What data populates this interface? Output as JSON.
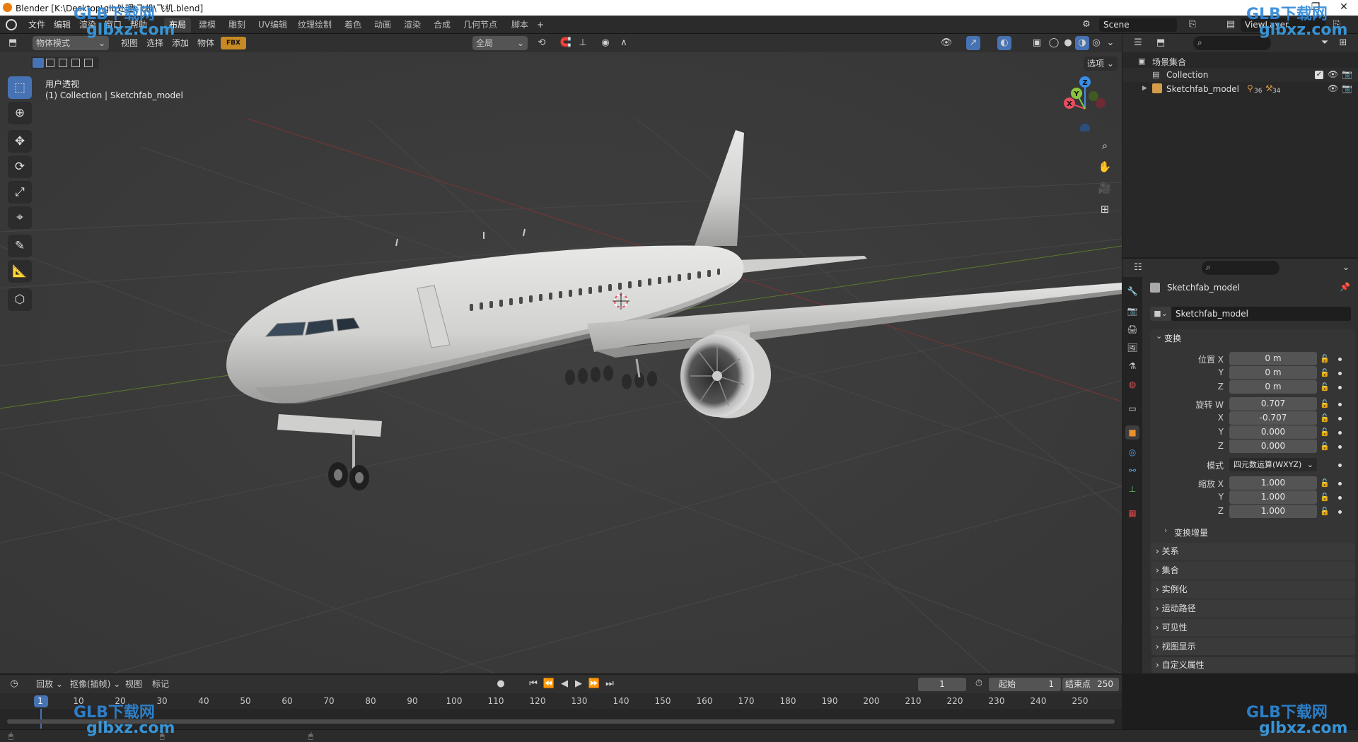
{
  "window": {
    "title": "Blender [K:\\Desktop\\glb处理\\飞机\\飞机.blend]",
    "controls": [
      "minimize",
      "maximize",
      "close"
    ]
  },
  "menubar": {
    "menus": [
      "文件",
      "编辑",
      "渲染",
      "窗口",
      "帮助"
    ],
    "workspaces": [
      "布局",
      "建模",
      "雕刻",
      "UV编辑",
      "纹理绘制",
      "着色",
      "动画",
      "渲染",
      "合成",
      "几何节点",
      "脚本"
    ],
    "active_workspace": "布局",
    "add_tab": "+",
    "scene": "Scene",
    "view_layer": "ViewLayer"
  },
  "viewport_header": {
    "mode": "物体模式",
    "menus": [
      "视图",
      "选择",
      "添加",
      "物体"
    ],
    "fbx_badge": "FBX",
    "transform_orientation": "全局",
    "options": "选项"
  },
  "viewport": {
    "view_name": "用户透视",
    "collection_info": "(1) Collection | Sketchfab_model",
    "gizmo_axes": [
      "Z",
      "Y",
      "X"
    ],
    "axis_colors": {
      "x": "#e84d5f",
      "y": "#8bc53f",
      "z": "#3a8ee6"
    }
  },
  "tools": [
    "select-box",
    "cursor",
    "move",
    "rotate",
    "scale",
    "transform",
    "annotate",
    "measure",
    "add-cube"
  ],
  "outliner": {
    "root": "场景集合",
    "items": [
      {
        "name": "Collection",
        "checked": true
      },
      {
        "name": "Sketchfab_model",
        "badge1": "36",
        "badge2": "34"
      }
    ]
  },
  "properties": {
    "object_name": "Sketchfab_model",
    "datablock_name": "Sketchfab_model",
    "transform_section": "变换",
    "location_label": "位置 X",
    "location": [
      "0 m",
      "0 m",
      "0 m"
    ],
    "rotation_label": "旋转 W",
    "rotation": [
      "0.707",
      "-0.707",
      "0.000",
      "0.000"
    ],
    "mode_label": "模式",
    "mode_value": "四元数运算(WXYZ)",
    "scale_label": "缩放 X",
    "scale": [
      "1.000",
      "1.000",
      "1.000"
    ],
    "axis_y": "Y",
    "axis_z": "Z",
    "axis_x": "X",
    "delta_transform": "变换增量",
    "panels": [
      "关系",
      "集合",
      "实例化",
      "运动路径",
      "可见性",
      "视图显示",
      "自定义属性"
    ]
  },
  "timeline": {
    "menus": [
      "回放",
      "抠像(插帧)",
      "视图",
      "标记"
    ],
    "current_frame": "1",
    "start_label": "起始",
    "start": "1",
    "end_label": "结束点",
    "end": "250",
    "ticks": [
      "1",
      "10",
      "20",
      "30",
      "40",
      "50",
      "60",
      "70",
      "80",
      "90",
      "100",
      "110",
      "120",
      "130",
      "140",
      "150",
      "160",
      "170",
      "180",
      "190",
      "200",
      "210",
      "220",
      "230",
      "240",
      "250"
    ]
  },
  "watermarks": {
    "brand": "GLB下载网",
    "url": "glbxz.com"
  }
}
